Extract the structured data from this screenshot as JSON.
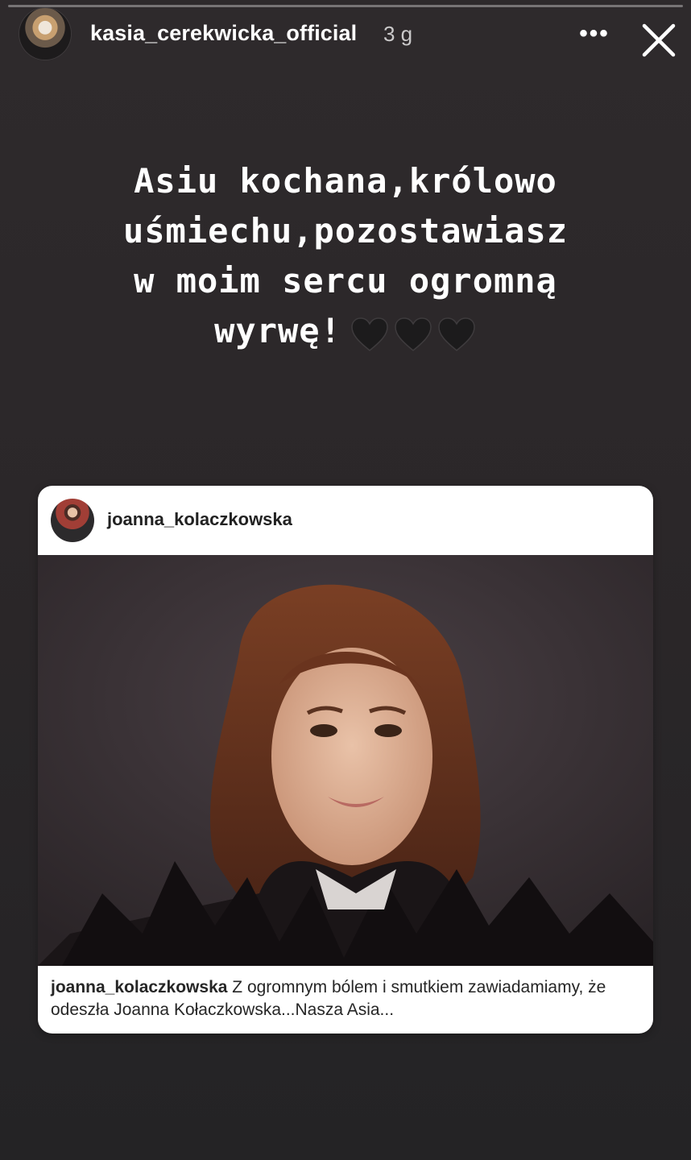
{
  "story": {
    "progress": 0.0,
    "author": {
      "username": "kasia_cerekwicka_official",
      "timestamp": "3 g"
    },
    "text_lines": [
      "Asiu kochana,królowo",
      "uśmiechu,pozostawiasz",
      "w moim sercu ogromną",
      "wyrwę!"
    ],
    "hearts": [
      "black-heart",
      "black-heart",
      "black-heart"
    ]
  },
  "controls": {
    "more_label": "•••",
    "close_icon": "close-icon"
  },
  "shared_post": {
    "username": "joanna_kolaczkowska",
    "caption_user": "joanna_kolaczkowska",
    "caption_text": "Z ogromnym bólem i smutkiem zawiadamiamy, że odeszła Joanna Kołaczkowska...Nasza Asia..."
  },
  "colors": {
    "background": "#2b2729",
    "text": "#ffffff",
    "card": "#ffffff"
  }
}
